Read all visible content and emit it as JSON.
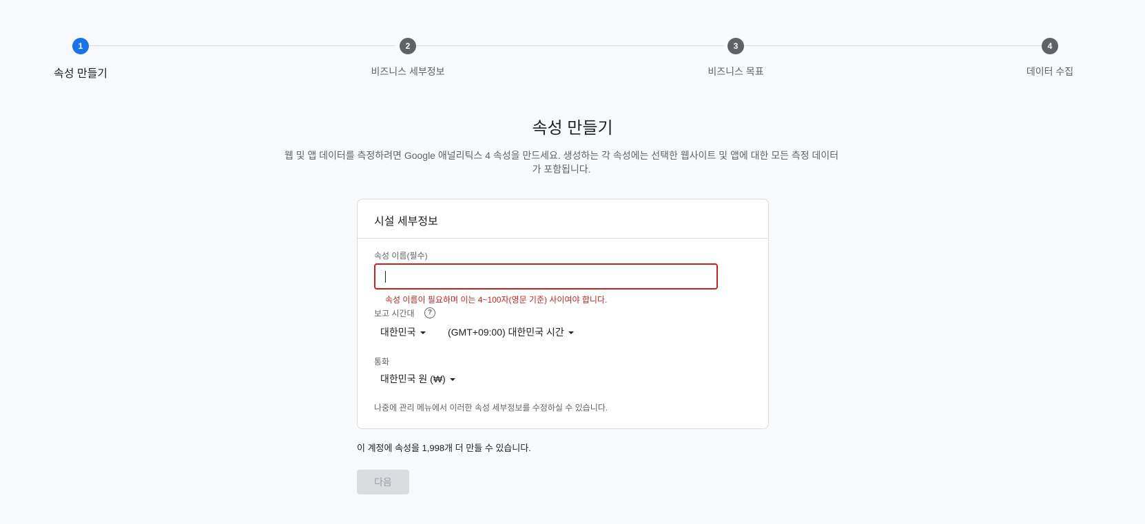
{
  "stepper": {
    "steps": [
      {
        "number": "1",
        "label": "속성 만들기"
      },
      {
        "number": "2",
        "label": "비즈니스 세부정보"
      },
      {
        "number": "3",
        "label": "비즈니스 목표"
      },
      {
        "number": "4",
        "label": "데이터 수집"
      }
    ],
    "active_step": 1
  },
  "header": {
    "title": "속성 만들기",
    "description": "웹 및 앱 데이터를 측정하려면 Google 애널리틱스 4 속성을 만드세요. 생성하는 각 속성에는 선택한 웹사이트 및 앱에 대한 모든 측정 데이터가 포함됩니다."
  },
  "card": {
    "title": "시설 세부정보",
    "property_name": {
      "label": "속성 이름(필수)",
      "value": "",
      "error": "속성 이름이 필요하며 이는 4~100자(영문 기준) 사이여야 합니다."
    },
    "timezone": {
      "label": "보고 시간대",
      "country": "대한민국",
      "zone": "(GMT+09:00) 대한민국 시간"
    },
    "currency": {
      "label": "통화",
      "value": "대한민국 원 (₩)"
    },
    "footnote": "나중에 관리 메뉴에서 이러한 속성 세부정보를 수정하실 수 있습니다."
  },
  "quota_text": "이 계정에 속성을 1,998개 더 만들 수 있습니다.",
  "next_button_label": "다음",
  "colors": {
    "accent": "#1a73e8",
    "error": "#c5221f",
    "inactive_step": "#5f6368",
    "disabled_button_bg": "#dadce0"
  }
}
